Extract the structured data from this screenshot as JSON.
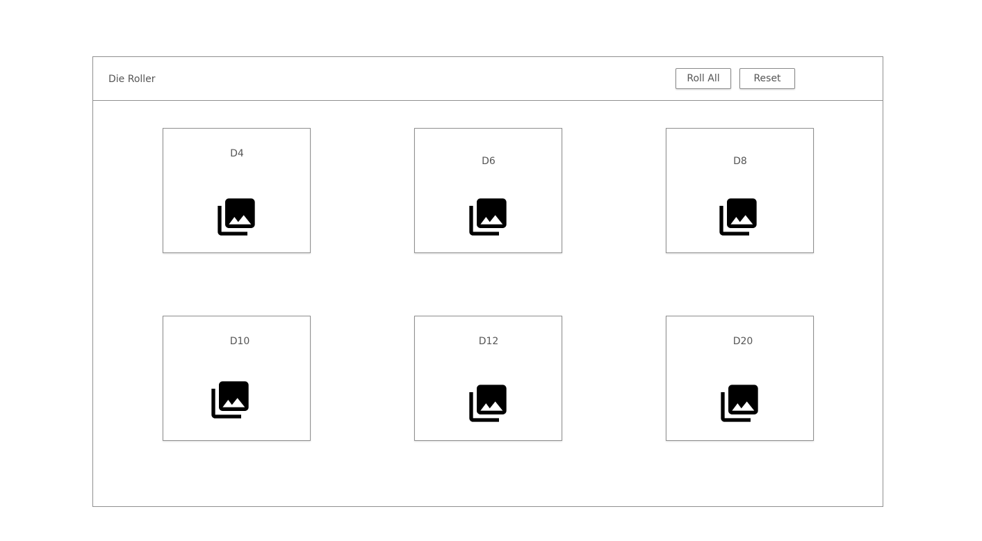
{
  "header": {
    "title": "Die Roller",
    "roll_all_label": "Roll All",
    "reset_label": "Reset"
  },
  "dice": [
    {
      "label": "D4",
      "icon": "image-gallery-icon"
    },
    {
      "label": "D6",
      "icon": "image-gallery-icon"
    },
    {
      "label": "D8",
      "icon": "image-gallery-icon"
    },
    {
      "label": "D10",
      "icon": "image-gallery-icon"
    },
    {
      "label": "D12",
      "icon": "image-gallery-icon"
    },
    {
      "label": "D20",
      "icon": "image-gallery-icon"
    }
  ],
  "colors": {
    "border": "#8f8f8f",
    "text": "#555555",
    "icon": "#000000",
    "background": "#ffffff"
  }
}
